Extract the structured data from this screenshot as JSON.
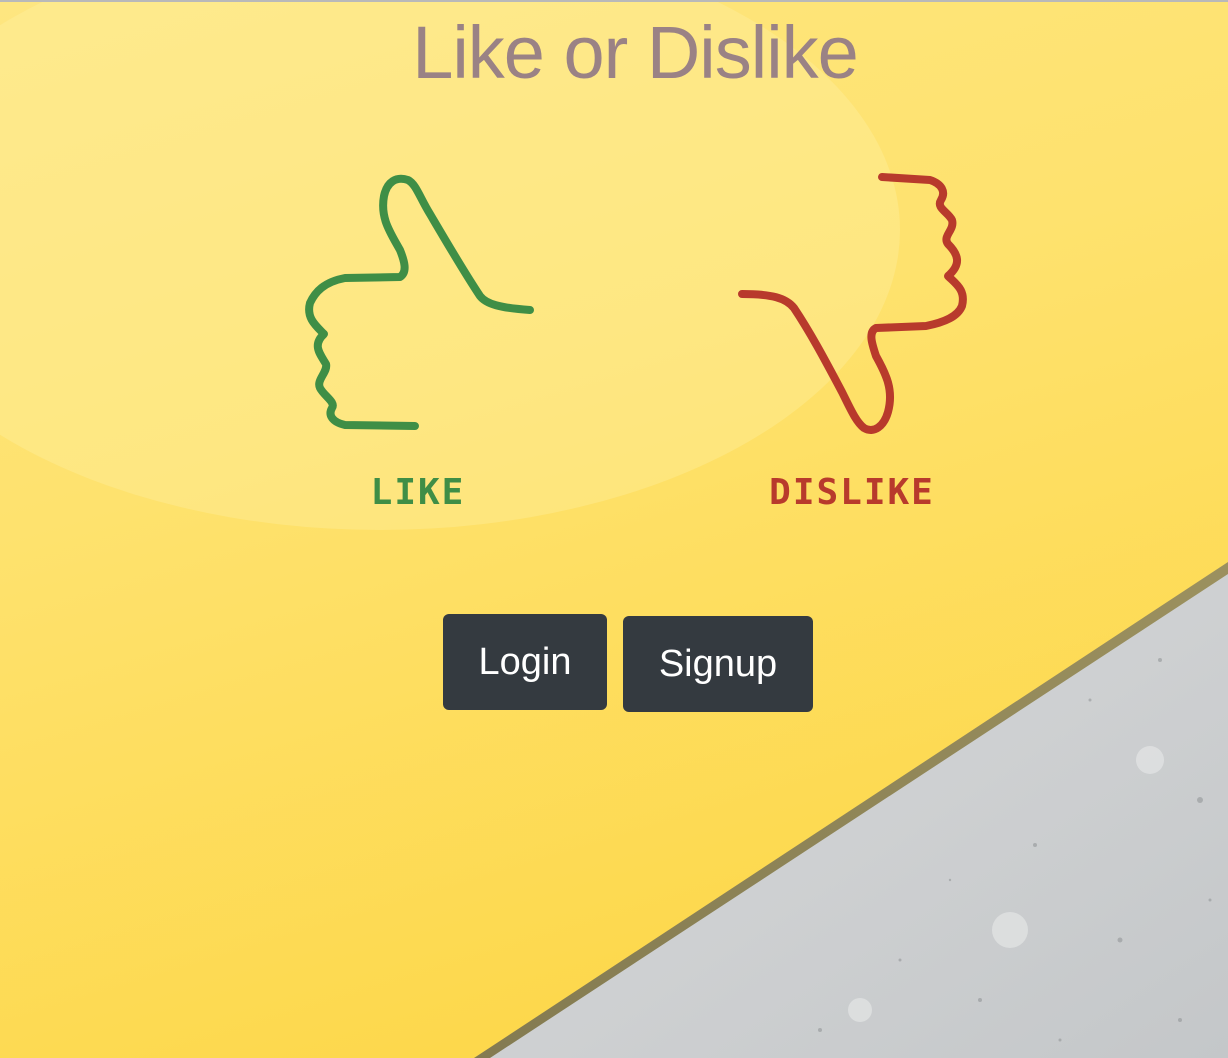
{
  "header": {
    "title": "Like or Dislike"
  },
  "hero": {
    "like_icon": "thumbs-up-icon",
    "like_label": "LIKE",
    "like_color": "#3f8e46",
    "dislike_icon": "thumbs-down-icon",
    "dislike_label": "DISLIKE",
    "dislike_color": "#b83a2c"
  },
  "actions": {
    "login_label": "Login",
    "signup_label": "Signup"
  },
  "colors": {
    "title": "#9a8285",
    "button_bg": "#343a40",
    "button_text": "#ffffff",
    "background_yellow": "#fde066",
    "background_concrete": "#cfd2d3"
  }
}
